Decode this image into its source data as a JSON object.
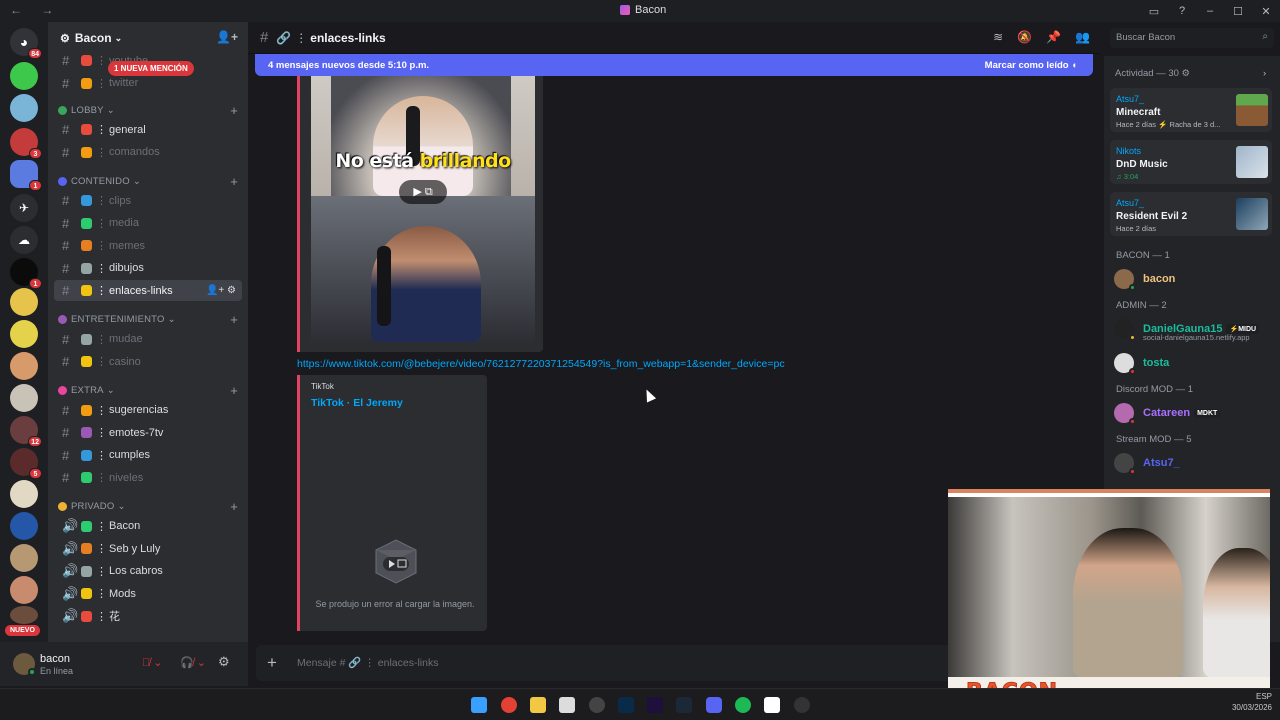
{
  "window": {
    "title": "Bacon",
    "nav": "← →"
  },
  "server": {
    "name": "Bacon"
  },
  "mention_badge": "1 NUEVA MENCIÓN",
  "nuevo_badge": "NUEVO",
  "guild_badges": [
    "84",
    "3",
    "1",
    "1",
    "12",
    "5"
  ],
  "channels": {
    "top": [
      {
        "label": "youtube",
        "state": "dim"
      },
      {
        "label": "twitter",
        "state": "dim"
      }
    ],
    "categories": [
      {
        "name": "LOBBY",
        "color": "#3ba55d",
        "items": [
          {
            "label": "general",
            "state": "bright"
          },
          {
            "label": "comandos",
            "state": "dim"
          }
        ]
      },
      {
        "name": "CONTENIDO",
        "color": "#5865f2",
        "items": [
          {
            "label": "clips",
            "state": "dim"
          },
          {
            "label": "media",
            "state": "dim"
          },
          {
            "label": "memes",
            "state": "dim"
          },
          {
            "label": "dibujos",
            "state": "bright"
          },
          {
            "label": "enlaces-links",
            "state": "active"
          }
        ]
      },
      {
        "name": "ENTRETENIMIENTO",
        "color": "#9b59b6",
        "items": [
          {
            "label": "mudae",
            "state": "dim"
          },
          {
            "label": "casino",
            "state": "dim"
          }
        ]
      },
      {
        "name": "EXTRA",
        "color": "#eb459e",
        "items": [
          {
            "label": "sugerencias",
            "state": "bright"
          },
          {
            "label": "emotes-7tv",
            "state": "bright"
          },
          {
            "label": "cumples",
            "state": "bright"
          },
          {
            "label": "niveles",
            "state": "dim"
          }
        ]
      },
      {
        "name": "PRIVADO",
        "color": "#f0b232",
        "items": [
          {
            "label": "Bacon",
            "state": "bright"
          },
          {
            "label": "Seb y Luly",
            "state": "bright"
          },
          {
            "label": "Los cabros",
            "state": "bright"
          },
          {
            "label": "Mods",
            "state": "bright"
          },
          {
            "label": "花",
            "state": "bright"
          }
        ]
      }
    ]
  },
  "user": {
    "name": "bacon",
    "status": "En línea"
  },
  "chat": {
    "channel": "enlaces-links",
    "new_messages": "4 mensajes nuevos desde 5:10 p.m.",
    "mark_read": "Marcar como leído",
    "video_caption_a": "No está ",
    "video_caption_b": "brillando",
    "link": "https://www.tiktok.com/@bebejere/video/7621277220371254549?is_from_webapp=1&sender_device=pc",
    "embed_provider": "TikTok",
    "embed_title": "TikTok · El Jeremy",
    "embed_error": "Se produjo un error al cargar la imagen.",
    "composer_placeholder": "Mensaje # 🔗 ⋮ enlaces-links"
  },
  "search": {
    "placeholder": "Buscar Bacon"
  },
  "activity": {
    "header": "Actividad — 30",
    "cards": [
      {
        "user": "Atsu7_",
        "game": "Minecraft",
        "sub": "Hace 2 días  ⚡ Racha de 3 d...",
        "green": false
      },
      {
        "user": "Nikots",
        "game": "DnD Music",
        "sub": "♫ 3:04",
        "green": true
      },
      {
        "user": "Atsu7_",
        "game": "Resident Evil 2",
        "sub": "Hace 2 días",
        "green": false
      }
    ]
  },
  "roles": [
    {
      "label": "BACON — 1",
      "members": [
        {
          "name": "bacon",
          "color": "#f0c27f",
          "tag": "",
          "sub": ""
        }
      ]
    },
    {
      "label": "ADMIN — 2",
      "members": [
        {
          "name": "DanielGauna15",
          "color": "#1abc9c",
          "tag": "⚡MIDU",
          "sub": "social-danielgauna15.netlify.app"
        },
        {
          "name": "tosta",
          "color": "#1abc9c",
          "tag": "",
          "sub": ""
        }
      ]
    },
    {
      "label": "Discord MOD — 1",
      "members": [
        {
          "name": "Catareen",
          "color": "#a970ff",
          "tag": "MDKT",
          "sub": ""
        }
      ]
    },
    {
      "label": "Stream MOD — 5",
      "members": [
        {
          "name": "Atsu7_",
          "color": "#5865f2",
          "tag": "",
          "sub": ""
        }
      ]
    }
  ],
  "webcam": {
    "brand": "BACON"
  },
  "tray": {
    "line1": "ESP",
    "line2": "30/03/2026"
  }
}
